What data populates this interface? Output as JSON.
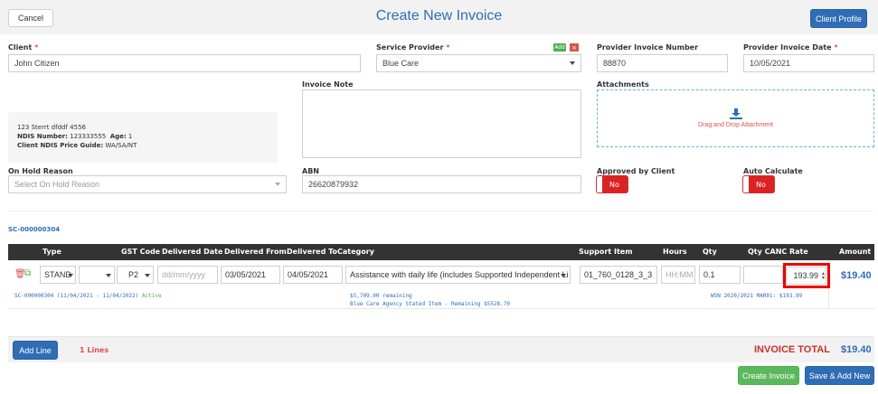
{
  "header": {
    "cancel_label": "Cancel",
    "title": "Create New Invoice",
    "client_profile_label": "Client Profile"
  },
  "form": {
    "client": {
      "label": "Client",
      "required": "*",
      "value": "John Citizen"
    },
    "service_provider": {
      "label": "Service Provider",
      "required": "*",
      "value": "Blue Care",
      "add_label": "Add",
      "remove_label": "×"
    },
    "provider_invoice_number": {
      "label": "Provider Invoice Number",
      "value": "88870"
    },
    "provider_invoice_date": {
      "label": "Provider Invoice Date",
      "required": "*",
      "value": "10/05/2021"
    },
    "client_info": {
      "address": "123 Sterrt dfddf 4556",
      "ndis_label": "NDIS Number:",
      "ndis_value": "123333555",
      "age_label": "Age:",
      "age_value": "1",
      "guide_label": "Client NDIS Price Guide:",
      "guide_value": "WA/SA/NT"
    },
    "invoice_note": {
      "label": "Invoice Note",
      "value": ""
    },
    "attachments": {
      "label": "Attachments",
      "drop_text": "Drag and Drop Attachment"
    },
    "on_hold_reason": {
      "label": "On Hold Reason",
      "placeholder": "Select On Hold Reason"
    },
    "abn": {
      "label": "ABN",
      "value": "26620879932"
    },
    "approved_by_client": {
      "label": "Approved by Client",
      "value": "No"
    },
    "auto_calculate": {
      "label": "Auto Calculate",
      "value": "No"
    }
  },
  "service_contract": "SC-000000304",
  "table": {
    "headers": [
      "Type",
      "GST Code",
      "Delivered Date",
      "Delivered From",
      "Delivered To",
      "Category",
      "Support Item",
      "Hours",
      "Qty",
      "Qty CANC",
      "Rate",
      "Amount"
    ],
    "row": {
      "type": "STAND",
      "gst_code": "P2",
      "delivered_date_placeholder": "dd/mm/yyyy",
      "delivered_from": "03/05/2021",
      "delivered_to": "04/05/2021",
      "category": "Assistance with daily life (includes Supported Independent Li",
      "support_item": "01_760_0128_3_3",
      "hours_placeholder": "HH:MM",
      "qty": "0.1",
      "qty_canc": "",
      "rate": "193.99",
      "amount": "$19.40",
      "contract_note": "SC-000000304 (11/04/2021 - 11/04/2022)",
      "contract_status": "Active",
      "remaining": "$5,709.00 remaining",
      "agency_remaining": "Blue Care Agency Stated Item - Remaining $5528.70",
      "price_note": "WSN 2020/2021 MAR01: $193.99"
    }
  },
  "footer": {
    "add_line_label": "Add Line",
    "lines_count": "1 Lines",
    "total_label": "INVOICE TOTAL",
    "total_value": "$19.40",
    "create_label": "Create Invoice",
    "save_add_label": "Save & Add New"
  },
  "colors": {
    "accent": "#2f6db5",
    "danger": "#d9534f",
    "success": "#5cb85c"
  }
}
